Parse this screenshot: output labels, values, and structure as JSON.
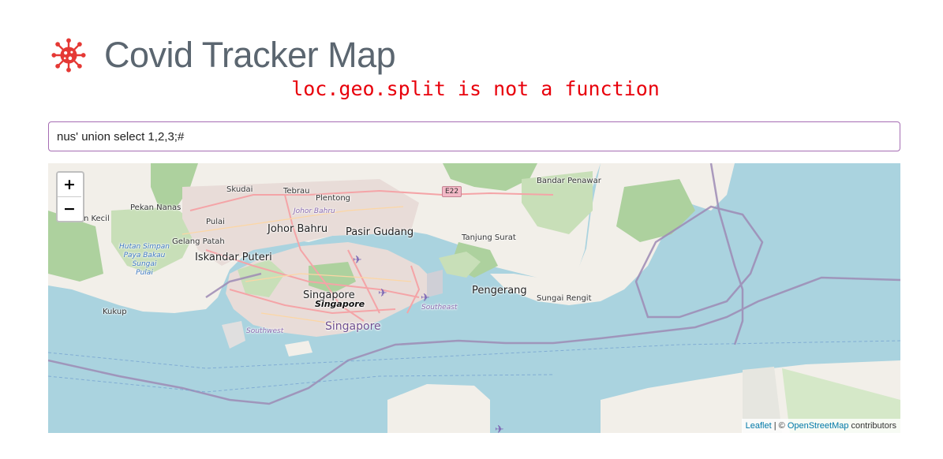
{
  "header": {
    "title": "Covid Tracker Map",
    "error": "loc.geo.split is not a function",
    "icon": "virus-icon",
    "icon_color": "#e53935"
  },
  "search": {
    "value": "nus' union select 1,2,3;#"
  },
  "map": {
    "zoom_in_label": "+",
    "zoom_out_label": "−",
    "attribution": {
      "leaflet": "Leaflet",
      "separator": " | © ",
      "osm": "OpenStreetMap",
      "suffix": " contributors"
    },
    "labels": {
      "skudai": "Skudai",
      "tebrau": "Tebrau",
      "plentong": "Plentong",
      "johor_bahru_it": "Johor Bahru",
      "pekan_nanas": "Pekan Nanas",
      "pulai": "Pulai",
      "johor_bahru": "Johor Bahru",
      "pasir_gudang": "Pasir Gudang",
      "pontian_kecil": "Pontian Kecil",
      "gelang_patah": "Gelang Patah",
      "iskandar_puteri": "Iskandar Puteri",
      "hutan_simpan": "Hutan Simpan\nPaya Bakau\nSungai\nPulai",
      "tanjung_surat": "Tanjung Surat",
      "bandar_penawar": "Bandar Penawar",
      "e22": "E22",
      "pengerang": "Pengerang",
      "sungai_rengit": "Sungai Rengit",
      "kukup": "Kukup",
      "singapore_city": "Singapore",
      "singapore_sub": "Singapore",
      "singapore_country": "Singapore",
      "southeast": "Southeast",
      "southwest": "Southwest"
    },
    "colors": {
      "sea": "#aad3df",
      "land": "#f2efe9",
      "forest": "#add19e",
      "urban": "#e8dcd8",
      "border": "#9e8bb5"
    }
  }
}
